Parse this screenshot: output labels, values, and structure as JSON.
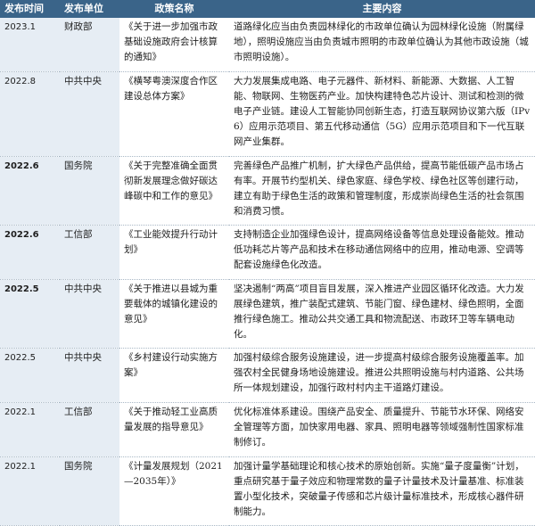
{
  "table": {
    "headers": [
      "发布时间",
      "发布单位",
      "政策名称",
      "主要内容"
    ],
    "rows": [
      {
        "date": "2023.1",
        "dept": "财政部",
        "name": "《关于进一步加强市政基础设施政府会计核算的通知》",
        "content": "道路绿化应当由负责园林绿化的市政单位确认为园林绿化设施（附属绿地），照明设施应当由负责城市照明的市政单位确认为其他市政设施（城市照明设施）。"
      },
      {
        "date": "2022.8",
        "dept": "中共中央",
        "name": "《横琴粤澳深度合作区建设总体方案》",
        "content": "大力发展集成电路、电子元器件、新材料、新能源、大数据、人工智能、物联网、生物医药产业。加快构建特色芯片设计、测试和检测的微电子产业链。建设人工智能协同创新生态，打造互联网协议第六版（IPv6）应用示范项目、第五代移动通信（5G）应用示范项目和下一代互联网产业集群。"
      },
      {
        "date": "2022.6",
        "dept": "国务院",
        "name": "《关于完整准确全面贯彻新发展理念做好碳达峰碳中和工作的意见》",
        "content": "完善绿色产品推广机制，扩大绿色产品供给，提高节能低碳产品市场占有率。开展节约型机关、绿色家庭、绿色学校、绿色社区等创建行动，建立有助于绿色生活的政策和管理制度，形成崇尚绿色生活的社会氛围和消费习惯。"
      },
      {
        "date": "2022.6",
        "dept": "工信部",
        "name": "《工业能效提升行动计划》",
        "content": "支持制造企业加强绿色设计，提高网络设备等信息处理设备能效。推动低功耗芯片等产品和技术在移动通信网络中的应用，推动电源、空调等配套设施绿色化改造。"
      },
      {
        "date": "2022.5",
        "dept": "中共中央",
        "name": "《关于推进以县城为重要载体的城镇化建设的意见》",
        "content": "坚决遏制“两高”项目盲目发展，深入推进产业园区循环化改造。大力发展绿色建筑，推广装配式建筑、节能门窗、绿色建材、绿色照明，全面推行绿色施工。推动公共交通工具和物流配送、市政环卫等车辆电动化。"
      },
      {
        "date": "2022.5",
        "dept": "中共中央",
        "name": "《乡村建设行动实施方案》",
        "content": "加强村级综合服务设施建设，进一步提高村级综合服务设施覆盖率。加强农村全民健身场地设施建设。推进公共照明设施与村内道路、公共场所一体规划建设，加强行政村村内主干道路灯建设。"
      },
      {
        "date": "2022.1",
        "dept": "工信部",
        "name": "《关于推动轻工业高质量发展的指导意见》",
        "content": "优化标准体系建设。围绕产品安全、质量提升、节能节水环保、网络安全管理等方面，加快家用电器、家具、照明电器等领域强制性国家标准制修订。"
      },
      {
        "date": "2022.1",
        "dept": "国务院",
        "name": "《计量发展规划（2021—2035年）》",
        "content": "加强计量学基础理论和核心技术的原始创新。实施“量子度量衡”计划，重点研究基于量子效应和物理常数的量子计量技术及计量基准、标准装置小型化技术，突破量子传感和芯片级计量标准技术，形成核心器件研制能力。"
      }
    ]
  },
  "colors": {
    "header_bg": "#3a6489",
    "header_text": "#ffffff",
    "label_cell_bg": "#e6edf4",
    "row_divider": "#a9b8c6"
  }
}
